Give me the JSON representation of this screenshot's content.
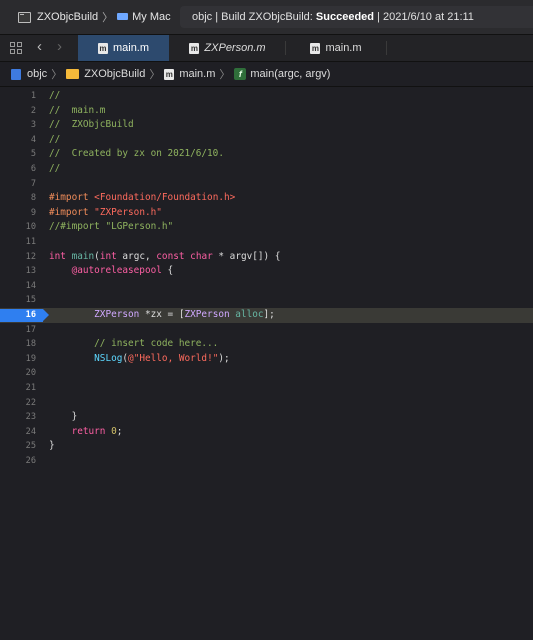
{
  "toolbar": {
    "scheme": "ZXObjcBuild",
    "destination": "My Mac",
    "status_prefix": "objc | Build ZXObjcBuild:",
    "status_result": "Succeeded",
    "status_time": "| 2021/6/10 at 21:11"
  },
  "tabs": [
    {
      "label": "main.m",
      "active": true
    },
    {
      "label": "ZXPerson.m",
      "active": false
    },
    {
      "label": "main.m",
      "active": false
    }
  ],
  "jumpbar": {
    "project": "objc",
    "group": "ZXObjcBuild",
    "file": "main.m",
    "symbol": "main(argc, argv)"
  },
  "editor": {
    "breakpoint_line": "16",
    "lines": [
      {
        "n": "1",
        "t": "//"
      },
      {
        "n": "2",
        "t": "//  main.m"
      },
      {
        "n": "3",
        "t": "//  ZXObjcBuild"
      },
      {
        "n": "4",
        "t": "//"
      },
      {
        "n": "5",
        "t": "//  Created by zx on 2021/6/10."
      },
      {
        "n": "6",
        "t": "//"
      },
      {
        "n": "7",
        "t": ""
      },
      {
        "n": "8",
        "t": "#import <Foundation/Foundation.h>"
      },
      {
        "n": "9",
        "t": "#import \"ZXPerson.h\""
      },
      {
        "n": "10",
        "t": "//#import \"LGPerson.h\""
      },
      {
        "n": "11",
        "t": ""
      },
      {
        "n": "12",
        "t": "int main(int argc, const char * argv[]) {"
      },
      {
        "n": "13",
        "t": "    @autoreleasepool {"
      },
      {
        "n": "14",
        "t": ""
      },
      {
        "n": "15",
        "t": ""
      },
      {
        "n": "16",
        "t": "        ZXPerson *zx = [ZXPerson alloc];"
      },
      {
        "n": "17",
        "t": ""
      },
      {
        "n": "18",
        "t": "        // insert code here..."
      },
      {
        "n": "19",
        "t": "        NSLog(@\"Hello, World!\");"
      },
      {
        "n": "20",
        "t": ""
      },
      {
        "n": "21",
        "t": ""
      },
      {
        "n": "22",
        "t": ""
      },
      {
        "n": "23",
        "t": "    }"
      },
      {
        "n": "24",
        "t": "    return 0;"
      },
      {
        "n": "25",
        "t": "}"
      },
      {
        "n": "26",
        "t": ""
      }
    ]
  }
}
